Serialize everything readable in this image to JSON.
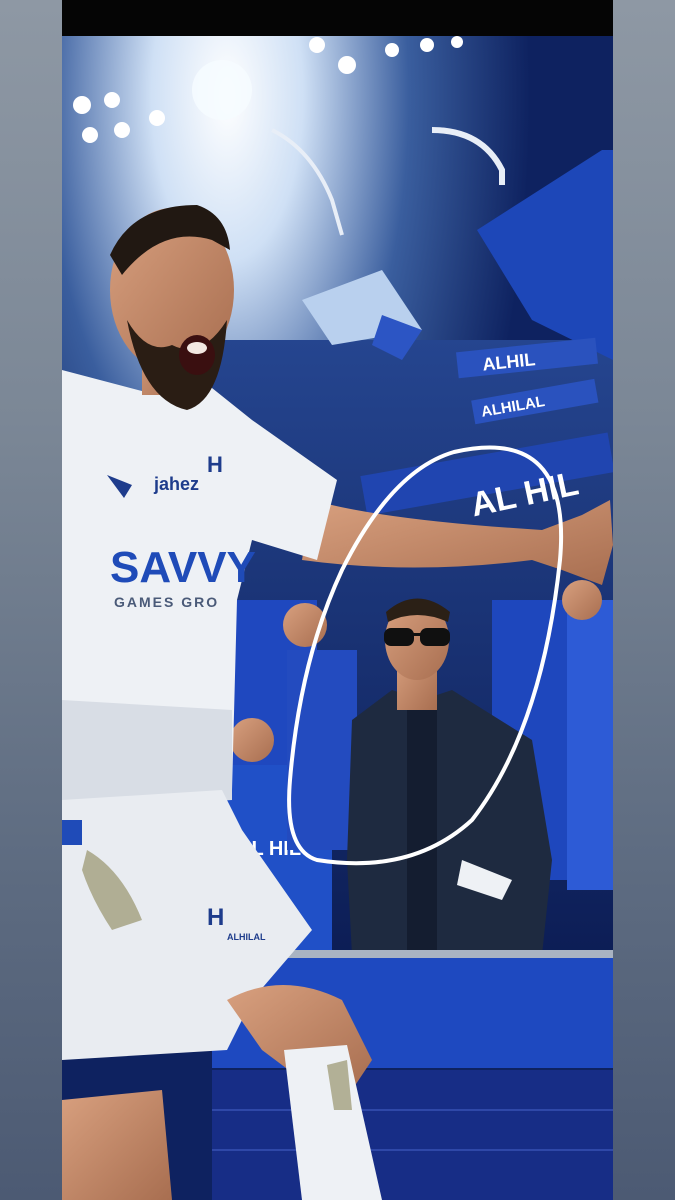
{
  "photo": {
    "jersey": {
      "sponsor_brand": "jahez",
      "sponsor_main": "SAVVY",
      "sponsor_sub": "GAMES GRO",
      "crest_text": "AL HILAL"
    },
    "fan_scarf_text": [
      "ALHIL",
      "ALHILAL",
      "AL HIL",
      "AL HIL"
    ],
    "shorts_crest_text": "ALHILAL"
  },
  "colors": {
    "hilal_blue": "#1f4bb8",
    "kit_white": "#eef1f5",
    "circle_annotation": "#ffffff",
    "letterbox": "#050505"
  }
}
